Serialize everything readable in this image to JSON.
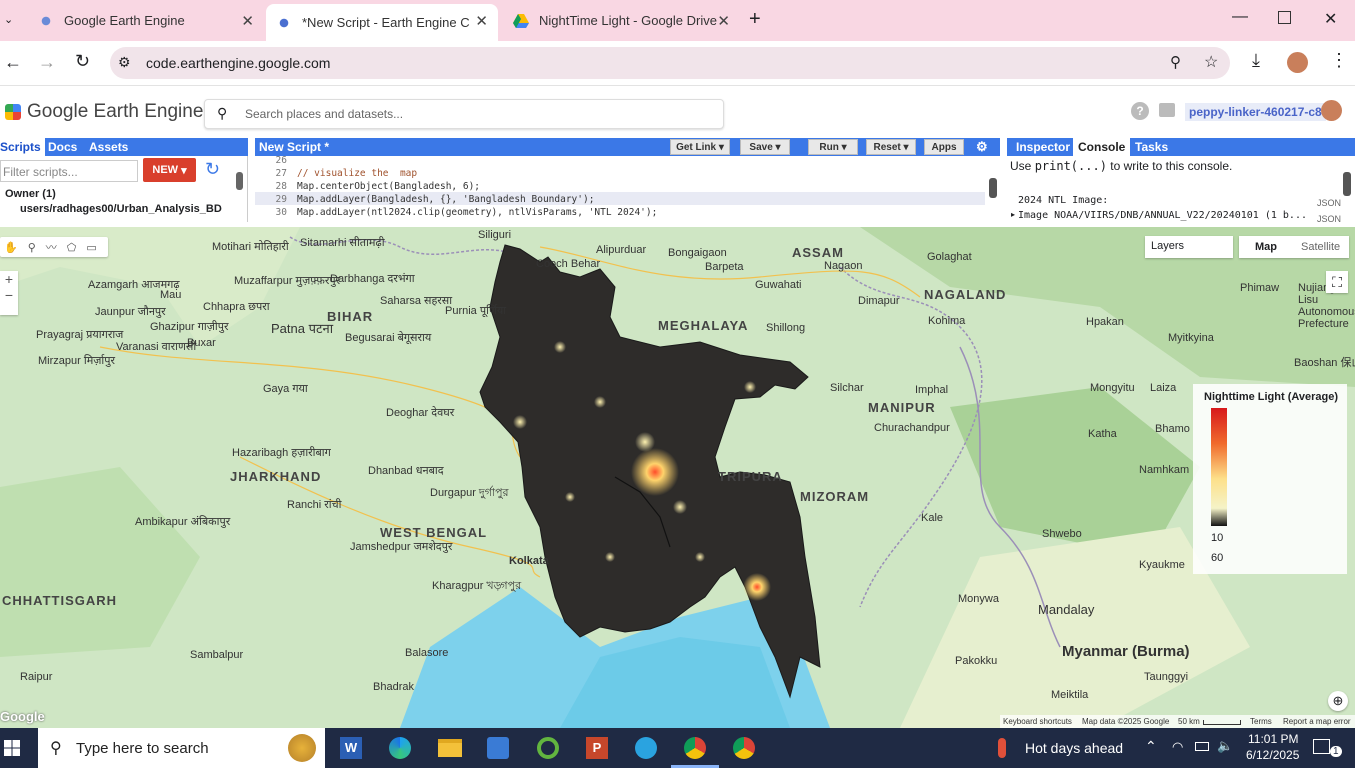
{
  "browser": {
    "tabs": [
      {
        "title": "Google Earth Engine",
        "active": false
      },
      {
        "title": "*New Script - Earth Engine Cod",
        "active": true
      },
      {
        "title": "NightTime Light - Google Drive",
        "active": false
      }
    ],
    "url": "code.earthengine.google.com"
  },
  "header": {
    "logo_text": "Google Earth Engine",
    "search_placeholder": "Search places and datasets...",
    "project": "peppy-linker-460217-c8"
  },
  "left_panel": {
    "tabs": [
      "Scripts",
      "Docs",
      "Assets"
    ],
    "filter_placeholder": "Filter scripts...",
    "new_label": "NEW",
    "owner": "Owner (1)",
    "repo": "users/radhages00/Urban_Analysis_BD"
  },
  "editor": {
    "title": "New Script *",
    "buttons": {
      "get_link": "Get Link",
      "save": "Save",
      "run": "Run",
      "reset": "Reset",
      "apps": "Apps"
    },
    "lines": [
      {
        "n": "26",
        "text": ""
      },
      {
        "n": "27",
        "text": "// visualize the  map"
      },
      {
        "n": "28",
        "text": "Map.centerObject(Bangladesh, 6);"
      },
      {
        "n": "29",
        "text": "Map.addLayer(Bangladesh, {}, 'Bangladesh Boundary');"
      },
      {
        "n": "30",
        "text": "Map.addLayer(ntl2024.clip(geometry), ntlVisParams, 'NTL 2024');"
      }
    ]
  },
  "right_panel": {
    "tabs": [
      "Inspector",
      "Console",
      "Tasks"
    ],
    "hint_pre": "Use ",
    "hint_code": "print(...)",
    "hint_post": " to write to this console.",
    "entry_title": "2024 NTL Image:",
    "entry_value": "Image NOAA/VIIRS/DNB/ANNUAL_V22/20240101 (1 b...",
    "json1": "JSON",
    "json2": "JSON"
  },
  "map": {
    "layers_label": "Layers",
    "map_label": "Map",
    "satellite_label": "Satellite",
    "legend_title": "Nighttime Light (Average)",
    "legend_min": "10",
    "legend_max": "60",
    "attribution": [
      "Keyboard shortcuts",
      "Map data ©2025 Google",
      "50 km",
      "Terms",
      "Report a map error"
    ],
    "google": "Google",
    "labels": [
      "Azamgarh आजमगढ़",
      "Mau",
      "Ghazipur गाज़ीपुर",
      "Jaunpur जौनपुर",
      "Varanasi वाराणसी",
      "Prayagraj प्रयागराज",
      "Mirzapur मिर्ज़ापुर",
      "Buxar",
      "Chhapra छपरा",
      "Patna पटना",
      "BIHAR",
      "Darbhanga दरभंगा",
      "Muzaffarpur मुज़फ़्फ़रपुर",
      "Sitamarhi सीतामढ़ी",
      "Motihari मोतिहारी",
      "Saharsa सहरसा",
      "Purnia पूर्णिया",
      "Begusarai बेगूसराय",
      "Gaya गया",
      "Deoghar देवघर",
      "Hazaribagh हज़ारीबाग",
      "JHARKHAND",
      "Dhanbad धनबाद",
      "Ranchi रांची",
      "Durgapur দুর্গাপুর",
      "WEST BENGAL",
      "Jamshedpur जमशेदपुर",
      "Kharagpur খড়্গপুর",
      "Ambikapur अंबिकापुर",
      "CHHATTISGARH",
      "Sambalpur",
      "Raipur",
      "Balasore",
      "Bhadrak",
      "Kolkata",
      "Bongaigaon",
      "Barpeta",
      "Guwahati",
      "ASSAM",
      "Nagaon",
      "MEGHALAYA",
      "Shillong",
      "Dimapur",
      "NAGALAND",
      "Kohima",
      "Silchar",
      "Imphal",
      "MANIPUR",
      "Churachandpur",
      "TRIPURA",
      "MIZORAM",
      "Kale",
      "Mandalay",
      "Myanmar (Burma)",
      "Monywa",
      "Shwebo",
      "Kyaukme",
      "Pakokku",
      "Meiktila",
      "Hpakan",
      "Myitkyina",
      "Mongyitu",
      "Laiza",
      "Katha",
      "Bhamo",
      "Namhkam",
      "Baoshan 保山市",
      "Nujiang Lisu Autonomous Prefecture",
      "Phimaw",
      "Golaghat",
      "Alipurduar",
      "Siliguri",
      "Cooch Behar",
      "Taunggyi"
    ]
  },
  "taskbar": {
    "search": "Type here to search",
    "weather": "Hot days ahead",
    "time": "11:01 PM",
    "date": "6/12/2025",
    "notif": "1"
  }
}
